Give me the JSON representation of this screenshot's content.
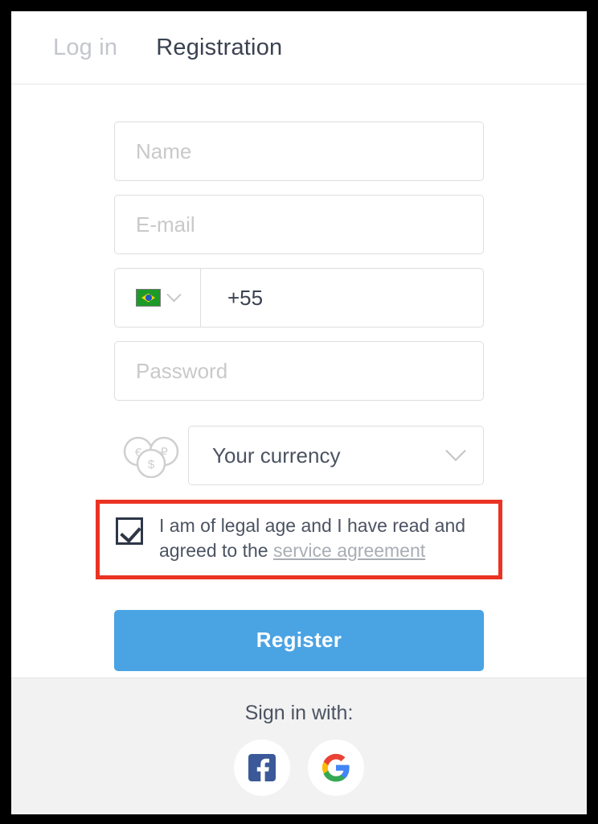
{
  "header": {
    "tabs": [
      {
        "label": "Log in",
        "active": false
      },
      {
        "label": "Registration",
        "active": true
      }
    ]
  },
  "form": {
    "name_placeholder": "Name",
    "email_placeholder": "E-mail",
    "country_flag": "brazil-flag-icon",
    "country_chevron": "chevron-down-icon",
    "phone_value": "+55",
    "password_placeholder": "Password",
    "coins_icon": "coins-icon",
    "currency_value": "Your currency",
    "currency_chevron": "chevron-down-icon",
    "agreement": {
      "checked": true,
      "text": "I am of legal age and I have read and agreed to the ",
      "link_text": "service agreement"
    },
    "submit_label": "Register"
  },
  "footer": {
    "title": "Sign in with:",
    "socials": [
      {
        "name": "facebook-icon",
        "label": "Facebook"
      },
      {
        "name": "google-icon",
        "label": "Google"
      }
    ]
  },
  "colors": {
    "accent_blue": "#4aa3e3",
    "highlight_red": "#ea3323",
    "facebook_blue": "#3b5998",
    "google_red": "#ea4335",
    "google_yellow": "#fbbc05",
    "google_green": "#34a853",
    "google_blue": "#4285f4",
    "text_dark": "#3a4251",
    "text_muted": "#c3c6cc",
    "border": "#dedede",
    "footer_bg": "#f2f2f2"
  }
}
